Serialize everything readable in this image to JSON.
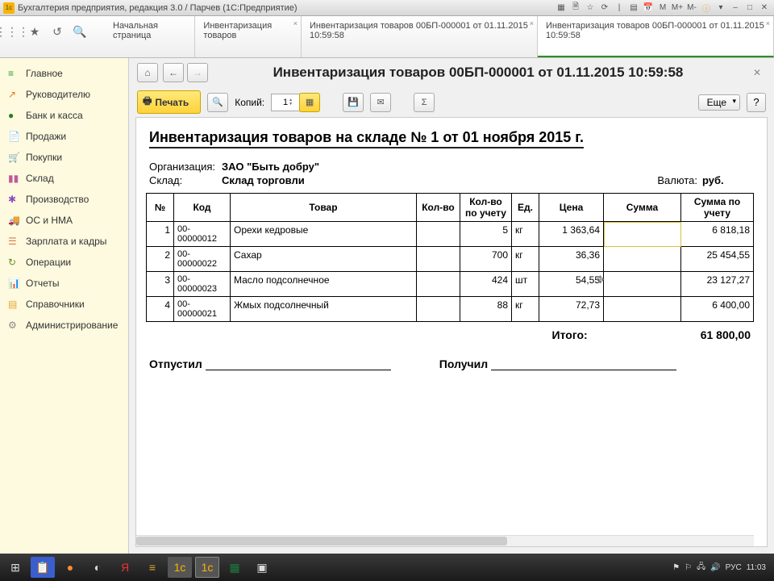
{
  "titlebar": {
    "title": "Бухгалтерия предприятия, редакция 3.0 / Парчев  (1С:Предприятие)",
    "m_buttons": [
      "M",
      "M+",
      "M-"
    ]
  },
  "tabs": [
    {
      "label": "Начальная страница",
      "close": false
    },
    {
      "label": "Инвентаризация товаров",
      "close": true
    },
    {
      "label": "Инвентаризация товаров 00БП-000001 от 01.11.2015 10:59:58",
      "close": true
    },
    {
      "label": "Инвентаризация товаров 00БП-000001 от 01.11.2015 10:59:58",
      "close": true,
      "active": true
    }
  ],
  "sidebar": [
    {
      "key": "main",
      "label": "Главное",
      "icon": "≡",
      "color": "#2aa02a"
    },
    {
      "key": "manager",
      "label": "Руководителю",
      "icon": "↗",
      "color": "#e67a17"
    },
    {
      "key": "bank",
      "label": "Банк и касса",
      "icon": "●",
      "color": "#2a7a2a"
    },
    {
      "key": "sales",
      "label": "Продажи",
      "icon": "📄",
      "color": "#cc8400"
    },
    {
      "key": "purchases",
      "label": "Покупки",
      "icon": "🛒",
      "color": "#19a96b"
    },
    {
      "key": "warehouse",
      "label": "Склад",
      "icon": "▮▮",
      "color": "#c05a9a"
    },
    {
      "key": "production",
      "label": "Производство",
      "icon": "✱",
      "color": "#8b4dbd"
    },
    {
      "key": "fixed",
      "label": "ОС и НМА",
      "icon": "🚚",
      "color": "#36a36a"
    },
    {
      "key": "salary",
      "label": "Зарплата и кадры",
      "icon": "☰",
      "color": "#dd7a4a"
    },
    {
      "key": "operations",
      "label": "Операции",
      "icon": "↻",
      "color": "#6a8f1f"
    },
    {
      "key": "reports",
      "label": "Отчеты",
      "icon": "📊",
      "color": "#3a67c7"
    },
    {
      "key": "catalogs",
      "label": "Справочники",
      "icon": "▤",
      "color": "#e7a630"
    },
    {
      "key": "admin",
      "label": "Администрирование",
      "icon": "⚙",
      "color": "#888"
    }
  ],
  "content": {
    "page_title": "Инвентаризация товаров 00БП-000001 от 01.11.2015 10:59:58",
    "print_label": "Печать",
    "copies_label": "Копий:",
    "copies_value": "1",
    "more_label": "Еще",
    "help_label": "?"
  },
  "doc": {
    "title": "Инвентаризация товаров на складе № 1 от 01 ноября 2015 г.",
    "org_label": "Организация:",
    "org_value": "ЗАО \"Быть добру\"",
    "wh_label": "Склад:",
    "wh_value": "Склад торговли",
    "cur_label": "Валюта:",
    "cur_value": "руб.",
    "cols": [
      "№",
      "Код",
      "Товар",
      "Кол-во",
      "Кол-во по учету",
      "Ед.",
      "Цена",
      "Сумма",
      "Сумма по учету"
    ],
    "rows": [
      {
        "n": "1",
        "code": "00-00000012",
        "name": "Орехи кедровые",
        "qty": "",
        "qty_acc": "5",
        "unit": "кг",
        "price": "1 363,64",
        "sum": "",
        "sum_acc": "6 818,18"
      },
      {
        "n": "2",
        "code": "00-00000022",
        "name": "Сахар",
        "qty": "",
        "qty_acc": "700",
        "unit": "кг",
        "price": "36,36",
        "sum": "",
        "sum_acc": "25 454,55"
      },
      {
        "n": "3",
        "code": "00-00000023",
        "name": "Масло подсолнечное",
        "qty": "",
        "qty_acc": "424",
        "unit": "шт",
        "price": "54,55",
        "sum": "",
        "sum_acc": "23 127,27"
      },
      {
        "n": "4",
        "code": "00-00000021",
        "name": "Жмых подсолнечный",
        "qty": "",
        "qty_acc": "88",
        "unit": "кг",
        "price": "72,73",
        "sum": "",
        "sum_acc": "6 400,00"
      }
    ],
    "total_label": "Итого:",
    "total_value": "61 800,00",
    "sign_out": "Отпустил",
    "sign_in": "Получил"
  },
  "taskbar": {
    "lang": "РУС",
    "clock": "11:03"
  }
}
